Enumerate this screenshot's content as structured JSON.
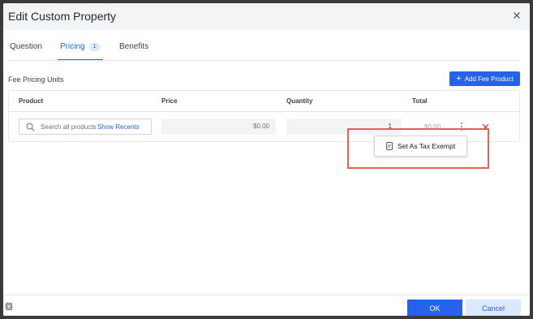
{
  "modal": {
    "title": "Edit Custom Property"
  },
  "tabs": [
    {
      "label": "Question",
      "active": false
    },
    {
      "label": "Pricing",
      "active": true,
      "badge": "1"
    },
    {
      "label": "Benefits",
      "active": false
    }
  ],
  "section": {
    "title": "Fee Pricing Units",
    "add_button_label": "Add Fee Product"
  },
  "table": {
    "headers": [
      "Product",
      "Price",
      "Quantity",
      "Total"
    ],
    "row": {
      "search_placeholder": "Search all products",
      "show_recents_label": "Show Recents",
      "price": "$0.00",
      "quantity": "1",
      "total": "$0.00"
    }
  },
  "dropdown": {
    "item_label": "Set As Tax Exempt"
  },
  "footer": {
    "ok_label": "OK",
    "cancel_label": "Cancel"
  },
  "colors": {
    "accent": "#2563eb",
    "highlight": "#e06652",
    "delete": "#dc2626"
  },
  "icons": [
    "close-icon",
    "search-icon",
    "kebab-icon",
    "delete-icon",
    "document-icon",
    "plus-icon",
    "corner-icon"
  ]
}
